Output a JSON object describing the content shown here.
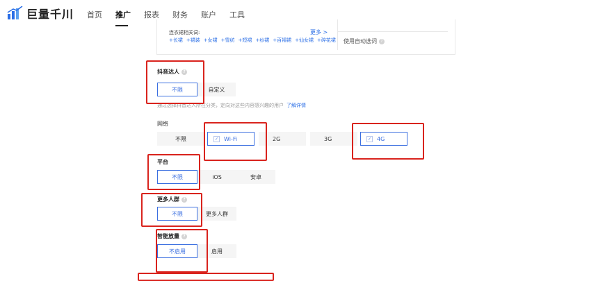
{
  "app": {
    "name": "巨量千川"
  },
  "nav": [
    {
      "label": "首页",
      "active": false
    },
    {
      "label": "推广",
      "active": true
    },
    {
      "label": "报表",
      "active": false
    },
    {
      "label": "财务",
      "active": false
    },
    {
      "label": "账户",
      "active": false
    },
    {
      "label": "工具",
      "active": false
    }
  ],
  "similar": {
    "title": "连衣裙相关词:",
    "more": "更多 >",
    "tags": [
      "+长裙",
      "+裙装",
      "+女裙",
      "+雪纺",
      "+短裙",
      "+纱裙",
      "+百褶裙",
      "+仙女裙",
      "+碎花裙"
    ]
  },
  "auto_option": {
    "label": "使用自动选词"
  },
  "douyin": {
    "label": "抖音达人",
    "options": [
      "不限",
      "自定义"
    ],
    "selected": "不限",
    "hint": "通过选择抖音达人所在分类，定向对这些内容感兴趣的用户",
    "hint_link": "了解详情"
  },
  "network": {
    "label": "网络",
    "options": [
      "不限",
      "Wi-Fi",
      "2G",
      "3G",
      "4G"
    ],
    "checked": [
      "Wi-Fi",
      "4G"
    ]
  },
  "platform": {
    "label": "平台",
    "options": [
      "不限",
      "iOS",
      "安卓"
    ],
    "selected": "不限"
  },
  "more_audience": {
    "label": "更多人群",
    "options": [
      "不限",
      "更多人群"
    ],
    "selected": "不限"
  },
  "smart_bid": {
    "label": "智能放量",
    "options": [
      "不启用",
      "启用"
    ],
    "selected": "不启用"
  },
  "colors": {
    "accent": "#3b6fe0",
    "annotation_red": "#d9231d",
    "link": "#2a6ee6"
  }
}
